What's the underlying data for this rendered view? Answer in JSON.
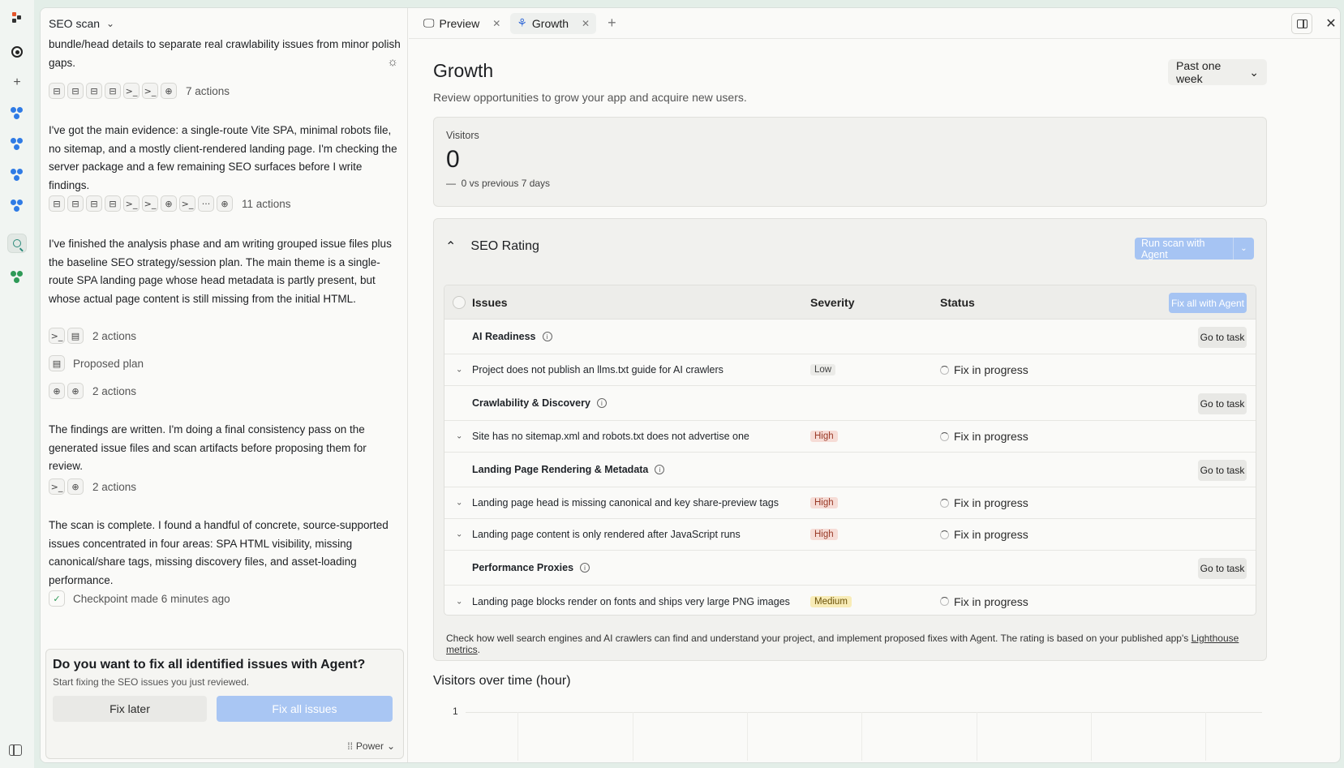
{
  "chat": {
    "title": "SEO scan",
    "messages": [
      {
        "text": "bundle/head details to separate real crawlability issues from minor polish gaps."
      },
      {
        "text": "I've got the main evidence: a single-route Vite SPA, minimal robots file, no sitemap, and a mostly client-rendered landing page. I'm checking the server package and a few remaining SEO surfaces before I write findings."
      },
      {
        "text": "I've finished the analysis phase and am writing grouped issue files plus the baseline SEO strategy/session plan. The main theme is a single-route SPA landing page whose head metadata is partly present, but whose actual page content is still missing from the initial HTML."
      },
      {
        "text": "The findings are written. I'm doing a final consistency pass on the generated issue files and scan artifacts before proposing them for review."
      },
      {
        "text": "The scan is complete. I found a handful of concrete, source-supported issues concentrated in four areas: SPA HTML visibility, missing canonical/share tags, missing discovery files, and asset-loading performance."
      }
    ],
    "action_groups": [
      {
        "label": "7 actions"
      },
      {
        "label": "11 actions"
      },
      {
        "label": "2 actions"
      },
      {
        "label": "2 actions"
      },
      {
        "label": "2 actions"
      }
    ],
    "proposed_plan": "Proposed plan",
    "checkpoint": "Checkpoint made 6 minutes ago",
    "prompt": {
      "title": "Do you want to fix all identified issues with Agent?",
      "subtitle": "Start fixing the SEO issues you just reviewed.",
      "later": "Fix later",
      "fix_all": "Fix all issues",
      "mode": "Power"
    }
  },
  "tabs": [
    {
      "label": "Preview",
      "icon": "monitor-icon"
    },
    {
      "label": "Growth",
      "icon": "growth-icon"
    }
  ],
  "growth": {
    "title": "Growth",
    "subtitle": "Review opportunities to grow your app and acquire new users.",
    "range": "Past one week",
    "visitors": {
      "label": "Visitors",
      "value": "0",
      "compare_dash": "—",
      "compare": "0 vs previous 7 days"
    },
    "seo": {
      "title": "SEO Rating",
      "run_button": "Run scan with Agent",
      "columns": {
        "issues": "Issues",
        "severity": "Severity",
        "status": "Status"
      },
      "fix_all": "Fix all with Agent",
      "goto": "Go to task",
      "groups": [
        {
          "name": "AI Readiness",
          "issues": [
            {
              "text": "Project does not publish an llms.txt guide for AI crawlers",
              "severity": "Low",
              "status": "Fix in progress"
            }
          ]
        },
        {
          "name": "Crawlability & Discovery",
          "issues": [
            {
              "text": "Site has no sitemap.xml and robots.txt does not advertise one",
              "severity": "High",
              "status": "Fix in progress"
            }
          ]
        },
        {
          "name": "Landing Page Rendering & Metadata",
          "issues": [
            {
              "text": "Landing page head is missing canonical and key share-preview tags",
              "severity": "High",
              "status": "Fix in progress"
            },
            {
              "text": "Landing page content is only rendered after JavaScript runs",
              "severity": "High",
              "status": "Fix in progress"
            }
          ]
        },
        {
          "name": "Performance Proxies",
          "issues": [
            {
              "text": "Landing page blocks render on fonts and ships very large PNG images",
              "severity": "Medium",
              "status": "Fix in progress"
            }
          ]
        }
      ],
      "footer_text": "Check how well search engines and AI crawlers can find and understand your project, and implement proposed fixes with Agent. The rating is based on your published app's ",
      "footer_link": "Lighthouse metrics",
      "footer_end": "."
    },
    "visitors_over_time": {
      "title": "Visitors over time (hour)",
      "y_tick": "1"
    }
  }
}
